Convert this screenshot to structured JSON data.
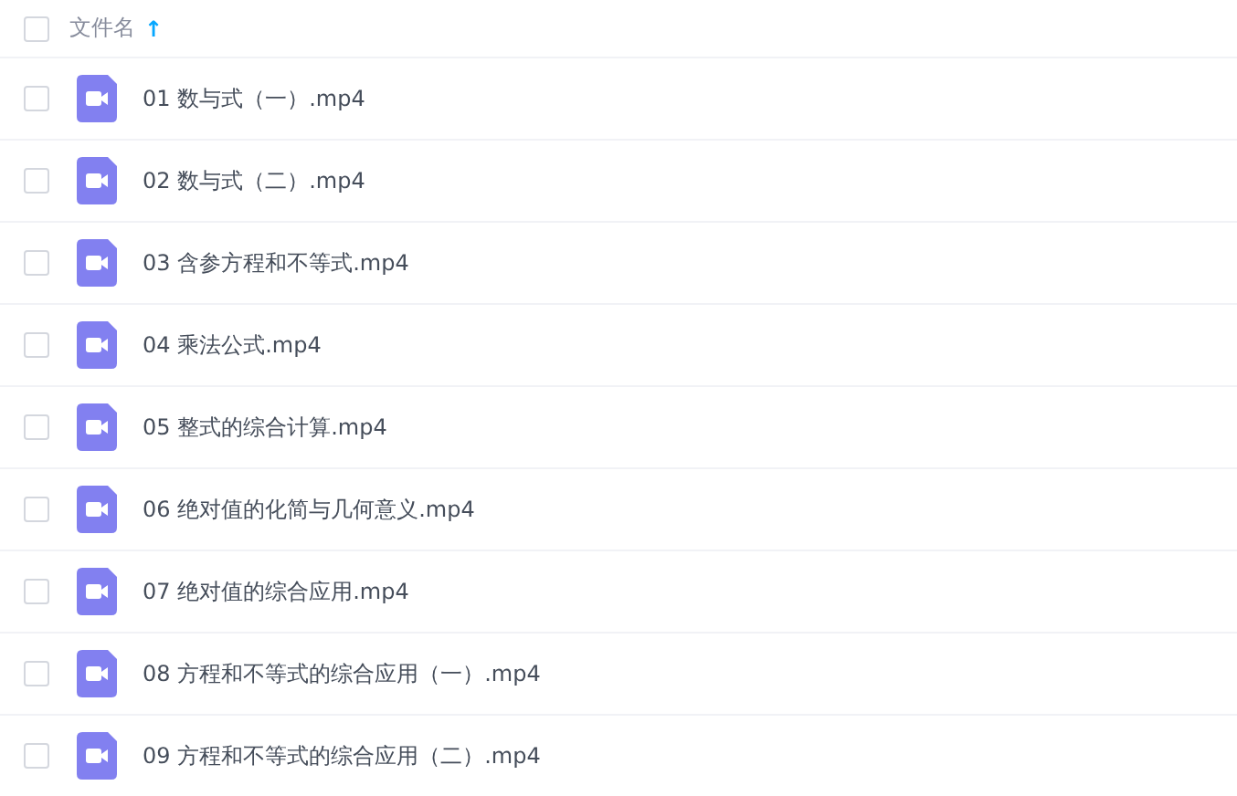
{
  "header": {
    "checked": false,
    "label": "文件名",
    "sort_arrow": "↑"
  },
  "files": [
    {
      "name": "01 数与式（一）.mp4",
      "checked": false
    },
    {
      "name": "02 数与式（二）.mp4",
      "checked": false
    },
    {
      "name": "03 含参方程和不等式.mp4",
      "checked": false
    },
    {
      "name": "04 乘法公式.mp4",
      "checked": false
    },
    {
      "name": "05 整式的综合计算.mp4",
      "checked": false
    },
    {
      "name": "06 绝对值的化简与几何意义.mp4",
      "checked": false
    },
    {
      "name": "07 绝对值的综合应用.mp4",
      "checked": false
    },
    {
      "name": "08 方程和不等式的综合应用（一）.mp4",
      "checked": false
    },
    {
      "name": "09 方程和不等式的综合应用（二）.mp4",
      "checked": false
    }
  ]
}
